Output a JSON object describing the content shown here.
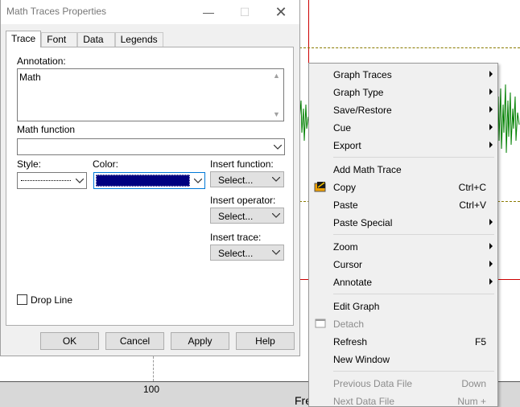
{
  "dialog": {
    "title": "Math Traces Properties",
    "tabs": [
      "Trace",
      "Font",
      "Data",
      "Legends"
    ],
    "annotation_label": "Annotation:",
    "annotation_value": "Math",
    "math_function_label": "Math function",
    "math_function_value": "",
    "style_label": "Style:",
    "color_label": "Color:",
    "color_value": "#000080",
    "insert_function_label": "Insert function:",
    "insert_function_value": "Select...",
    "insert_operator_label": "Insert operator:",
    "insert_operator_value": "Select...",
    "insert_trace_label": "Insert trace:",
    "insert_trace_value": "Select...",
    "drop_line_label": "Drop Line",
    "drop_line_checked": false,
    "buttons": {
      "ok": "OK",
      "cancel": "Cancel",
      "apply": "Apply",
      "help": "Help"
    }
  },
  "graph": {
    "x_tick_label": "100",
    "x_axis_label_partial": "Fre"
  },
  "menu": {
    "items": [
      {
        "label": "Graph Traces",
        "submenu": true
      },
      {
        "label": "Graph Type",
        "submenu": true
      },
      {
        "label": "Save/Restore",
        "submenu": true
      },
      {
        "label": "Cue",
        "submenu": true
      },
      {
        "label": "Export",
        "submenu": true
      },
      {
        "label": "Add Math Trace"
      },
      {
        "label": "Copy",
        "shortcut": "Ctrl+C",
        "icon": "copy-icon"
      },
      {
        "label": "Paste",
        "shortcut": "Ctrl+V"
      },
      {
        "label": "Paste Special",
        "submenu": true
      },
      {
        "label": "Zoom",
        "submenu": true
      },
      {
        "label": "Cursor",
        "submenu": true
      },
      {
        "label": "Annotate",
        "submenu": true
      },
      {
        "label": "Edit Graph"
      },
      {
        "label": "Detach",
        "disabled": true,
        "icon": "detach-icon"
      },
      {
        "label": "Refresh",
        "shortcut": "F5"
      },
      {
        "label": "New Window"
      },
      {
        "label": "Previous Data File",
        "shortcut": "Down",
        "disabled": true
      },
      {
        "label": "Next Data File",
        "shortcut": "Num +",
        "disabled": true
      }
    ]
  }
}
